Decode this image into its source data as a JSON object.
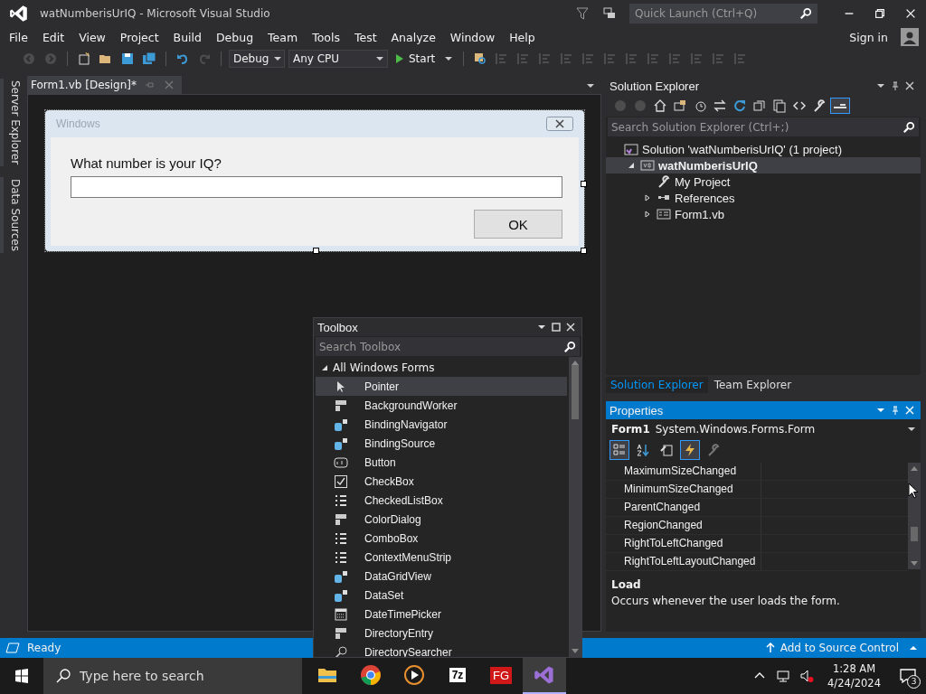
{
  "window": {
    "title": "watNumberisUrIQ - Microsoft Visual Studio"
  },
  "quick_launch": {
    "placeholder": "Quick Launch (Ctrl+Q)"
  },
  "menu": [
    "File",
    "Edit",
    "View",
    "Project",
    "Build",
    "Debug",
    "Team",
    "Tools",
    "Test",
    "Analyze",
    "Window",
    "Help"
  ],
  "sign_in": "Sign in",
  "toolbar": {
    "configuration": "Debug",
    "platform": "Any CPU",
    "start": "Start"
  },
  "side_tabs": [
    "Server Explorer",
    "Data Sources"
  ],
  "document_tabs": [
    {
      "label": "Form1.vb [Design]*",
      "selected": true
    }
  ],
  "form": {
    "title": "Windows",
    "prompt": "What number is your IQ?",
    "button": "OK"
  },
  "solution_explorer": {
    "title": "Solution Explorer",
    "search_placeholder": "Search Solution Explorer (Ctrl+;)",
    "tree": [
      {
        "label": "Solution 'watNumberisUrIQ' (1 project)",
        "kind": "solution",
        "selected": false,
        "children": [
          {
            "label": "watNumberisUrIQ",
            "kind": "project",
            "selected": true,
            "expanded": true,
            "children": [
              {
                "label": "My Project",
                "kind": "settings",
                "selected": false
              },
              {
                "label": "References",
                "kind": "references",
                "selected": false,
                "expanded": false
              },
              {
                "label": "Form1.vb",
                "kind": "form",
                "selected": false,
                "expanded": false
              }
            ]
          }
        ]
      }
    ]
  },
  "panel_tabs": [
    {
      "label": "Solution Explorer",
      "selected": true
    },
    {
      "label": "Team Explorer",
      "selected": false
    }
  ],
  "properties": {
    "title": "Properties",
    "object_name": "Form1",
    "object_type": "System.Windows.Forms.Form",
    "tools": [
      {
        "kind": "categorized",
        "selected": true
      },
      {
        "kind": "alphabetical",
        "selected": false
      },
      {
        "kind": "property-pages",
        "selected": false
      },
      {
        "kind": "events",
        "selected": true
      },
      {
        "kind": "wrench",
        "selected": false
      }
    ],
    "events": [
      "MaximumSizeChanged",
      "MinimumSizeChanged",
      "ParentChanged",
      "RegionChanged",
      "RightToLeftChanged",
      "RightToLeftLayoutChanged"
    ],
    "description_title": "Load",
    "description": "Occurs whenever the user loads the form."
  },
  "toolbox": {
    "title": "Toolbox",
    "search_placeholder": "Search Toolbox",
    "group": "All Windows Forms",
    "items": [
      {
        "label": "Pointer",
        "kind": "pointer",
        "selected": true
      },
      {
        "label": "BackgroundWorker",
        "kind": "component",
        "selected": false
      },
      {
        "label": "BindingNavigator",
        "kind": "data",
        "selected": false
      },
      {
        "label": "BindingSource",
        "kind": "data",
        "selected": false
      },
      {
        "label": "Button",
        "kind": "button",
        "selected": false
      },
      {
        "label": "CheckBox",
        "kind": "checkbox",
        "selected": false
      },
      {
        "label": "CheckedListBox",
        "kind": "list",
        "selected": false
      },
      {
        "label": "ColorDialog",
        "kind": "component",
        "selected": false
      },
      {
        "label": "ComboBox",
        "kind": "list",
        "selected": false
      },
      {
        "label": "ContextMenuStrip",
        "kind": "list",
        "selected": false
      },
      {
        "label": "DataGridView",
        "kind": "data",
        "selected": false
      },
      {
        "label": "DataSet",
        "kind": "data",
        "selected": false
      },
      {
        "label": "DateTimePicker",
        "kind": "calendar",
        "selected": false
      },
      {
        "label": "DirectoryEntry",
        "kind": "component",
        "selected": false
      },
      {
        "label": "DirectorySearcher",
        "kind": "search",
        "selected": false
      }
    ]
  },
  "status_bar": {
    "text": "Ready",
    "source_control": "Add to Source Control"
  },
  "taskbar": {
    "search_placeholder": "Type here to search",
    "apps": [
      {
        "kind": "folder",
        "selected": false
      },
      {
        "kind": "browser",
        "selected": false
      },
      {
        "kind": "player",
        "selected": false
      },
      {
        "kind": "archiver",
        "label": "7z",
        "selected": false
      },
      {
        "kind": "fg",
        "label": "FG",
        "selected": false
      },
      {
        "kind": "vs",
        "selected": true
      }
    ],
    "time": "1:28 AM",
    "date": "4/24/2024",
    "notifications": "3"
  }
}
